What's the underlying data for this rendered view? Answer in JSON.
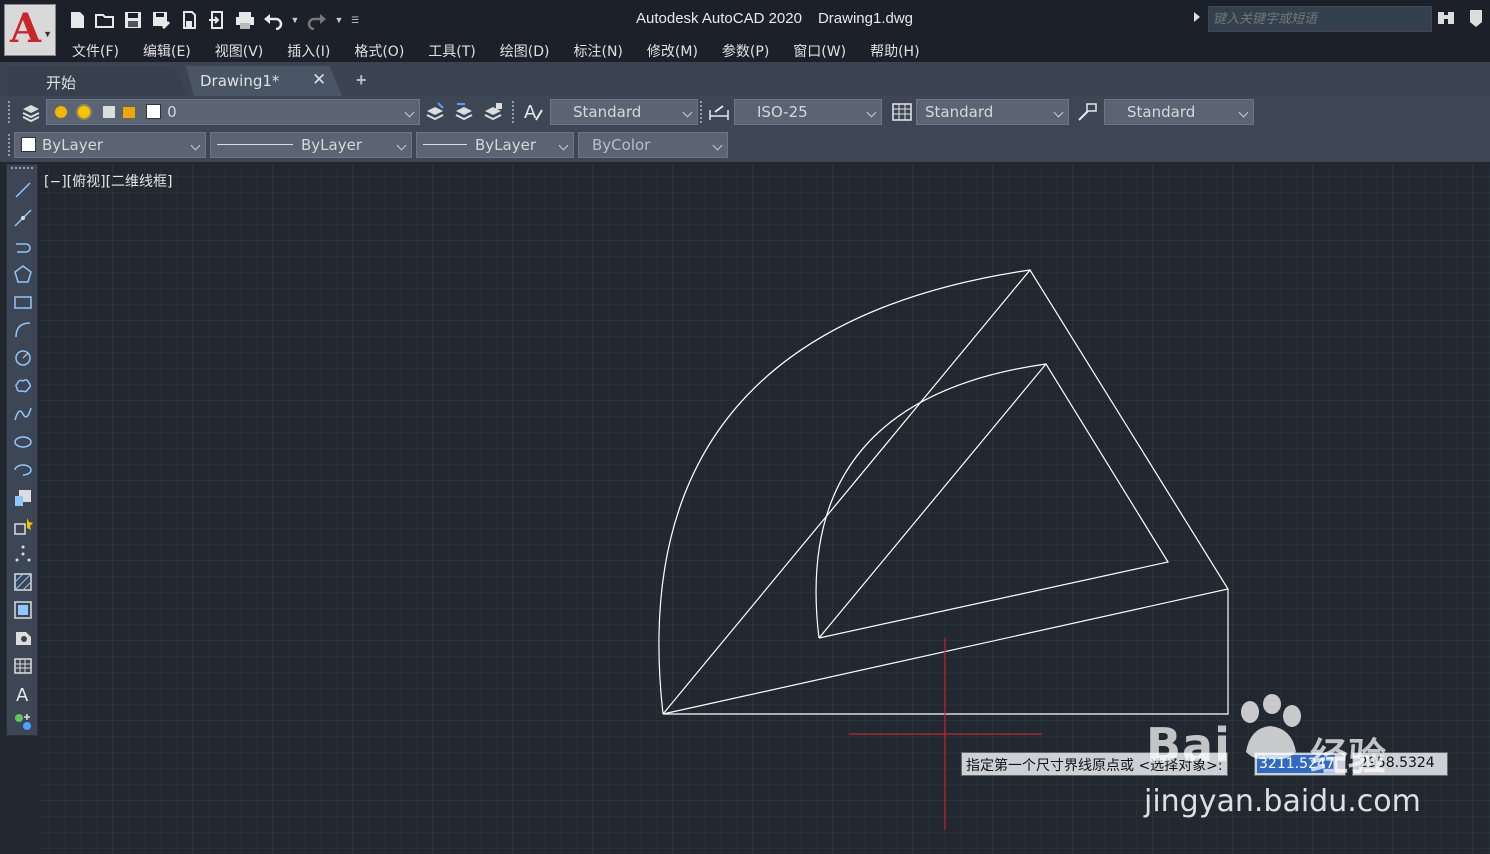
{
  "app": {
    "logo_letter": "A",
    "title_product": "Autodesk AutoCAD 2020",
    "title_file": "Drawing1.dwg"
  },
  "search": {
    "placeholder": "键入关键字或短语"
  },
  "menu": [
    "文件(F)",
    "编辑(E)",
    "视图(V)",
    "插入(I)",
    "格式(O)",
    "工具(T)",
    "绘图(D)",
    "标注(N)",
    "修改(M)",
    "参数(P)",
    "窗口(W)",
    "帮助(H)"
  ],
  "tabs": {
    "start": "开始",
    "drawing": "Drawing1*",
    "close_glyph": "✕",
    "add_glyph": "+"
  },
  "toolbar1": {
    "layer_value": "0",
    "text_style": "Standard",
    "dim_style": "ISO-25",
    "table_style": "Standard",
    "multileader_style": "Standard"
  },
  "toolbar2": {
    "color": "ByLayer",
    "linetype": "ByLayer",
    "lineweight": "ByLayer",
    "plotstyle": "ByColor"
  },
  "viewport": {
    "label": "[−][俯视][二维线框]"
  },
  "dynamic_input": {
    "prompt": "指定第一个尺寸界线原点或 <选择对象>:",
    "x_value": "3211.5247",
    "y_value": "2958.5324"
  },
  "watermark": {
    "brand": "Bai",
    "brand_cn": "经验",
    "url": "jingyan.baidu.com"
  },
  "colors": {
    "background": "#212830",
    "crosshair": "#c8202a",
    "geometry": "#ffffff",
    "logo_red": "#c8262a",
    "highlight": "#2f6bc4"
  },
  "icons": {
    "palette": [
      "line-icon",
      "construction-line-icon",
      "polyline-icon",
      "polygon-icon",
      "rectangle-icon",
      "arc-icon",
      "circle-icon",
      "revision-cloud-icon",
      "spline-icon",
      "ellipse-icon",
      "ellipse-arc-icon",
      "insert-block-icon",
      "make-block-icon",
      "point-icon",
      "hatch-icon",
      "gradient-icon",
      "region-icon",
      "table-icon",
      "multiline-text-icon",
      "add-selected-icon"
    ]
  }
}
